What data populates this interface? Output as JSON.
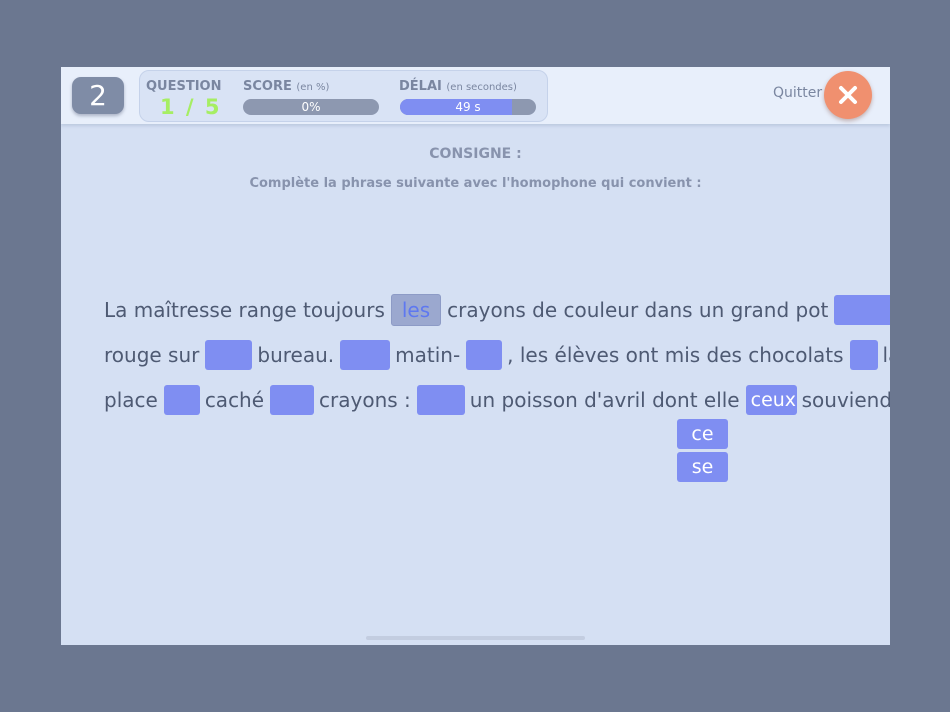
{
  "header": {
    "level": "2",
    "question_label": "QUESTION",
    "question_count": "1 / 5",
    "score_label": "SCORE",
    "score_unit": "(en %)",
    "score_value": "0%",
    "score_fraction": 0,
    "delay_label": "DÉLAI",
    "delay_unit": "(en secondes)",
    "delay_value": "49 s",
    "delay_fraction": 0.82,
    "quit_label": "Quitter",
    "quit_icon": "close-icon"
  },
  "consigne": {
    "title": "CONSIGNE :",
    "text": "Complète la phrase suivante avec l'homophone qui convient :"
  },
  "sentence": {
    "w1": "La maîtresse range toujours",
    "filled_answer": "les",
    "w2": "crayons de couleur dans un grand pot",
    "w3": "rouge sur",
    "w4": "bureau.",
    "w5": "matin-",
    "w6": ", les élèves ont mis des chocolats",
    "w7": "la",
    "w8": "place",
    "w9": "caché",
    "w10": "crayons :",
    "w11": "un poisson d'avril dont elle",
    "w12": "souviendra !"
  },
  "dropdown": {
    "current": "ceux",
    "options": [
      "ce",
      "se"
    ]
  },
  "colors": {
    "background": "#6b7790",
    "panel": "#d5e0f3",
    "blank": "#7f8ef2",
    "quit_button": "#f0906f",
    "question_count": "#a6ee63"
  }
}
